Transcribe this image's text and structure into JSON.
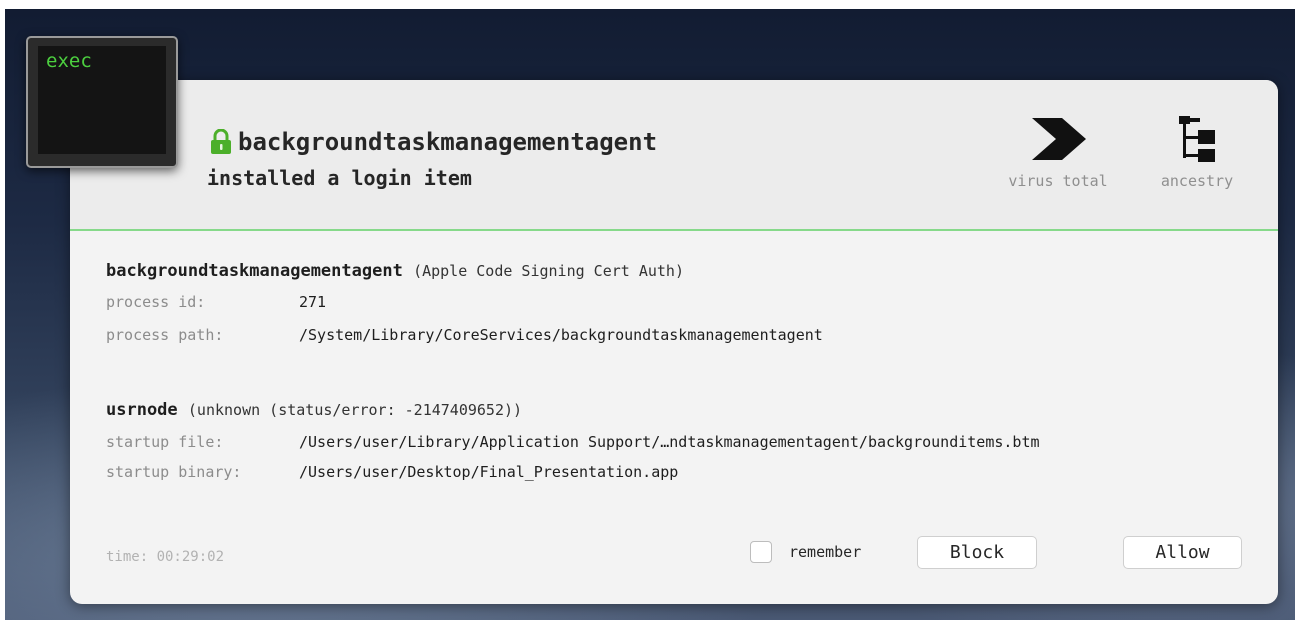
{
  "icon_label": "exec",
  "header": {
    "title": "backgroundtaskmanagementagent",
    "subtitle": "installed a login item",
    "tools": [
      {
        "label": "virus total",
        "icon": "virustotal-icon"
      },
      {
        "label": "ancestry",
        "icon": "ancestry-tree-icon"
      }
    ]
  },
  "process": {
    "name": "backgroundtaskmanagementagent",
    "signer": "(Apple Code Signing Cert Auth)",
    "fields": [
      {
        "key": "process id:",
        "value": "271"
      },
      {
        "key": "process path:",
        "value": "/System/Library/CoreServices/backgroundtaskmanagementagent"
      }
    ]
  },
  "item": {
    "name": "usrnode",
    "signer": "(unknown (status/error: -2147409652))",
    "fields": [
      {
        "key": "startup file:",
        "value": "/Users/user/Library/Application Support/…ndtaskmanagementagent/backgrounditems.btm"
      },
      {
        "key": "startup binary:",
        "value": "/Users/user/Desktop/Final_Presentation.app"
      }
    ]
  },
  "footer": {
    "time": "time: 00:29:02",
    "remember_label": "remember",
    "block_label": "Block",
    "allow_label": "Allow"
  },
  "colors": {
    "accent_green": "#86d98a",
    "lock_green": "#4caf2a",
    "terminal_green": "#4ccf3f"
  }
}
